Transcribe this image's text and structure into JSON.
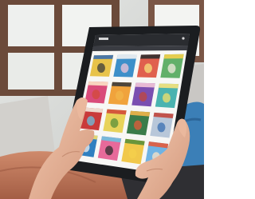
{
  "scene": {
    "subject": "tablet-held-in-hands",
    "setting": "living-room-window",
    "device": "tablet",
    "screen_content": "magazine-cover-grid",
    "grid": {
      "rows": 4,
      "columns": 4
    },
    "colors": {
      "wall": "#d7d9d6",
      "window_frame": "#6b4a3a",
      "window_glass": "#eef0ee",
      "sofa": "#c9c7c4",
      "cushion": "#3b7fb7",
      "tablet_body": "#1b1d20",
      "screen_bg": "#f7f7f5",
      "app_bar": "#2a2c30",
      "skin": "#e8b49a",
      "sweater": "#c47a5c"
    }
  }
}
